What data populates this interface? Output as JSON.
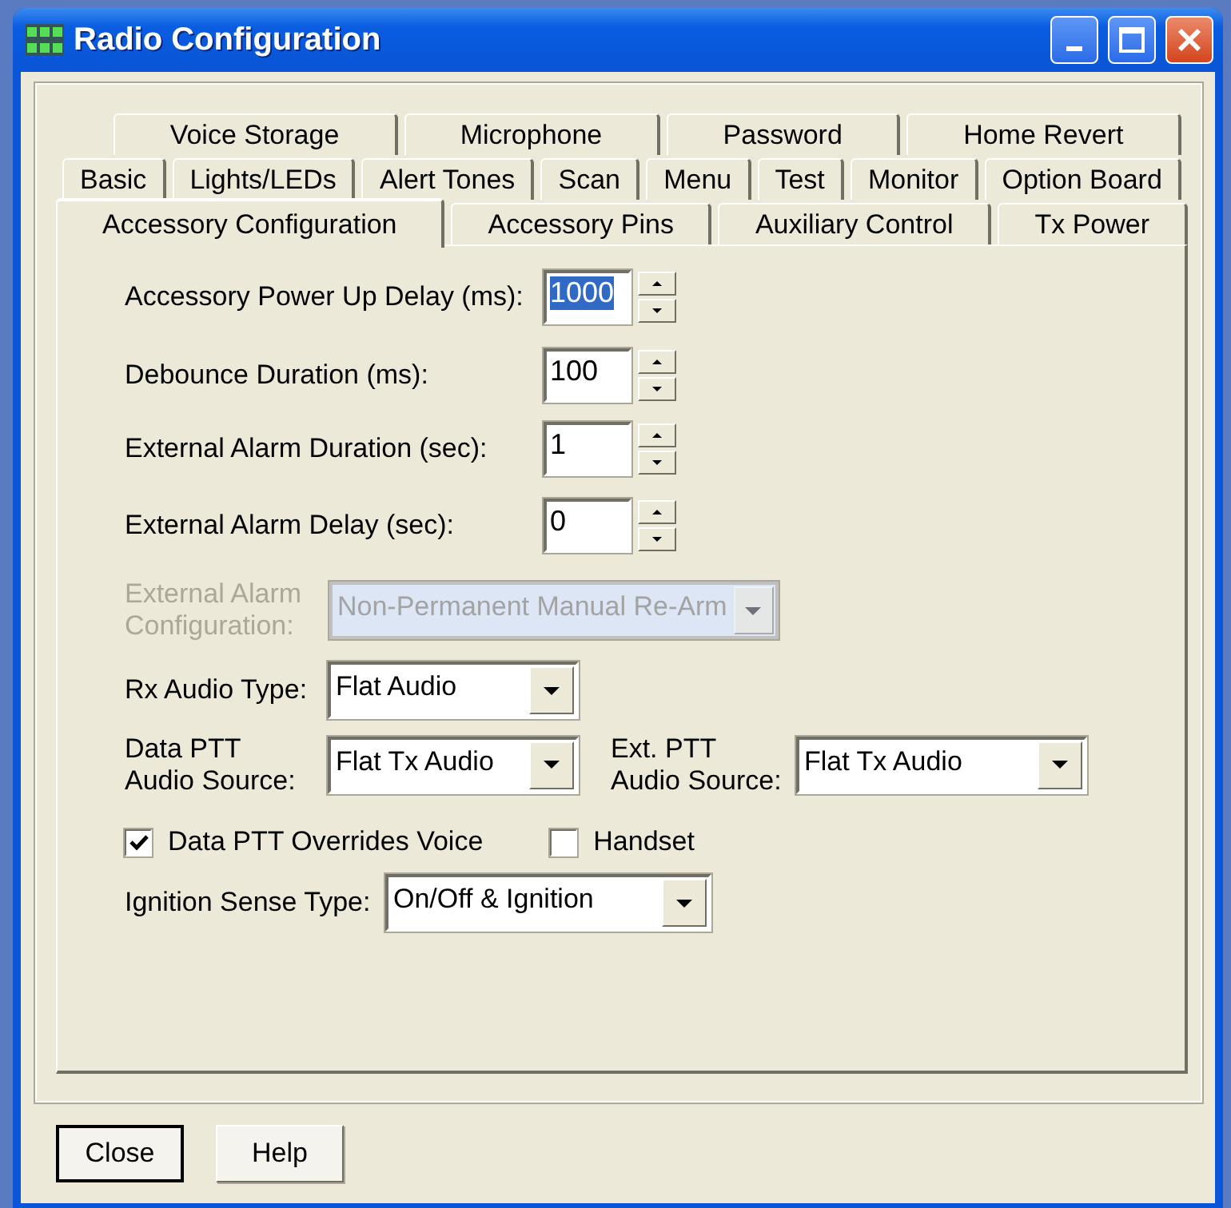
{
  "window": {
    "title": "Radio Configuration"
  },
  "tab_rows": [
    [
      {
        "label": "Voice Storage",
        "selected": false
      },
      {
        "label": "Microphone",
        "selected": false
      },
      {
        "label": "Password",
        "selected": false
      },
      {
        "label": "Home Revert",
        "selected": false
      }
    ],
    [
      {
        "label": "Basic",
        "selected": false
      },
      {
        "label": "Lights/LEDs",
        "selected": false
      },
      {
        "label": "Alert Tones",
        "selected": false
      },
      {
        "label": "Scan",
        "selected": false
      },
      {
        "label": "Menu",
        "selected": false
      },
      {
        "label": "Test",
        "selected": false
      },
      {
        "label": "Monitor",
        "selected": false
      },
      {
        "label": "Option Board",
        "selected": false
      }
    ],
    [
      {
        "label": "Accessory Configuration",
        "selected": true
      },
      {
        "label": "Accessory Pins",
        "selected": false
      },
      {
        "label": "Auxiliary Control",
        "selected": false
      },
      {
        "label": "Tx Power",
        "selected": false
      }
    ]
  ],
  "form": [
    {
      "items": [
        {
          "kind": "spin",
          "label": "Accessory Power Up Delay (ms):",
          "value": "1000",
          "highlighted": true
        }
      ]
    },
    {
      "items": [
        {
          "kind": "spin",
          "label": "Debounce Duration (ms):",
          "value": "100",
          "highlighted": false
        }
      ]
    },
    {
      "items": [
        {
          "kind": "spin",
          "label": "External Alarm Duration (sec):",
          "value": "1",
          "highlighted": false
        }
      ]
    },
    {
      "items": [
        {
          "kind": "spin",
          "label": "External Alarm Delay (sec):",
          "value": "0",
          "highlighted": false
        }
      ]
    },
    {
      "items": [
        {
          "kind": "combo",
          "label": "External Alarm\nConfiguration:",
          "value": "Non-Permanent Manual Re-Arm",
          "disabled": true
        }
      ]
    },
    {
      "items": [
        {
          "kind": "combo",
          "label": "Rx Audio Type:",
          "value": "Flat Audio",
          "disabled": false
        }
      ]
    },
    {
      "items": [
        {
          "kind": "combo",
          "label": "Data PTT\nAudio Source:",
          "value": "Flat Tx Audio",
          "disabled": false
        },
        {
          "kind": "combo",
          "label": "Ext. PTT\nAudio Source:",
          "value": "Flat Tx Audio",
          "disabled": false
        }
      ]
    },
    {
      "items": [
        {
          "kind": "check",
          "label": "Data PTT Overrides Voice",
          "checked": true
        },
        {
          "kind": "check",
          "label": "Handset",
          "checked": false
        }
      ]
    },
    {
      "items": [
        {
          "kind": "combo",
          "label": "Ignition Sense Type:",
          "value": "On/Off & Ignition",
          "disabled": false
        }
      ]
    }
  ],
  "buttons": [
    {
      "label": "Close",
      "default": true
    },
    {
      "label": "Help",
      "default": false
    }
  ]
}
